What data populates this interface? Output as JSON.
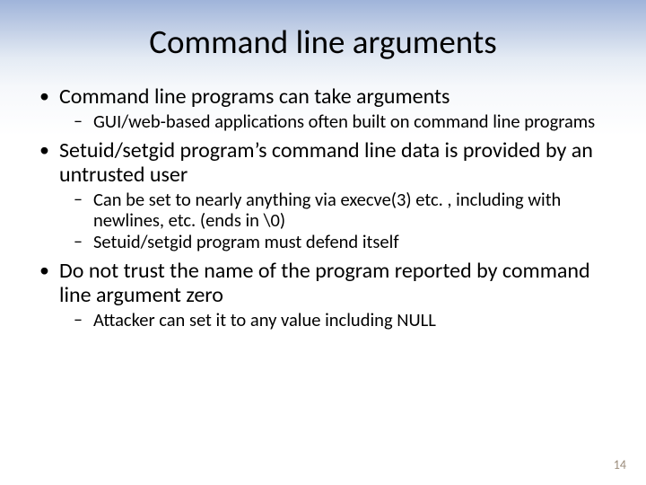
{
  "title": "Command line arguments",
  "bullets": [
    {
      "text": "Command line programs can take arguments",
      "sub": [
        "GUI/web-based applications often built on command line programs"
      ]
    },
    {
      "text": "Setuid/setgid program’s command line data is provided by an untrusted user",
      "sub": [
        "Can be set to nearly anything via execve(3) etc. , including with newlines, etc. (ends in \\0)",
        "Setuid/setgid program must defend itself"
      ]
    },
    {
      "text": "Do not trust the name of the program reported by command line argument zero",
      "sub": [
        "Attacker can set it to any value including NULL"
      ]
    }
  ],
  "page_number": "14"
}
